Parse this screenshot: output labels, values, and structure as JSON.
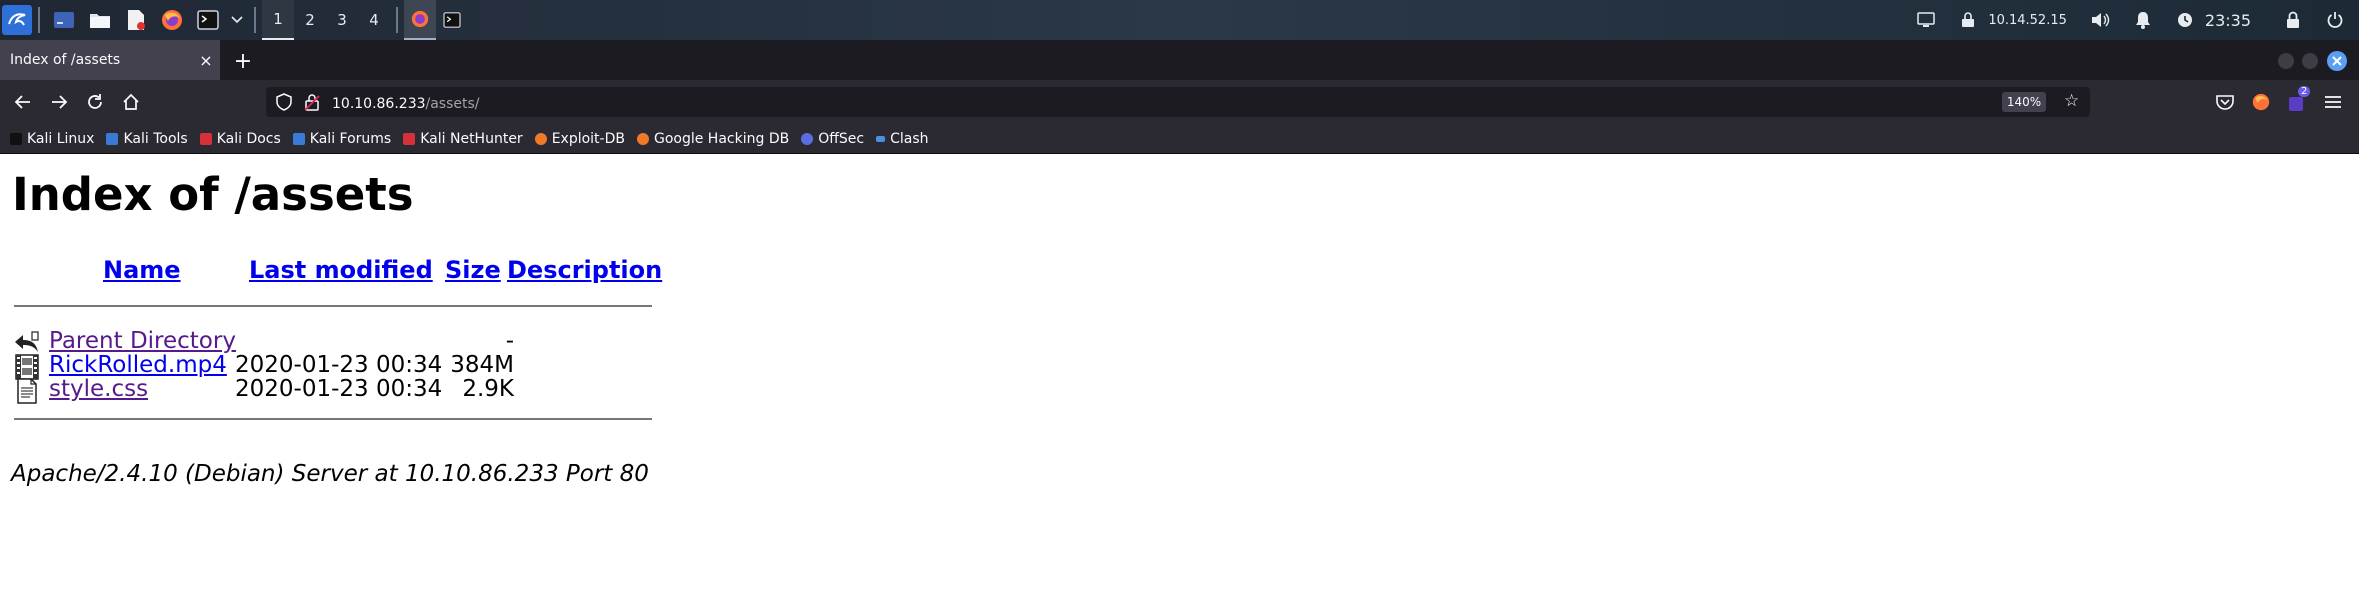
{
  "panel": {
    "workspaces": [
      "1",
      "2",
      "3",
      "4"
    ],
    "ip": "10.14.52.15",
    "clock": "23:35"
  },
  "browser": {
    "tab_title": "Index of /assets",
    "tab_close": "×",
    "new_tab": "+",
    "url_host": "10.10.86.233",
    "url_path": "/assets/",
    "zoom": "140%",
    "extension_badge": "2"
  },
  "bookmarks": [
    {
      "label": "Kali Linux",
      "icon": "kali-dragon-icon",
      "color": "#111111"
    },
    {
      "label": "Kali Tools",
      "icon": "kali-tools-icon",
      "color": "#3a7bd5"
    },
    {
      "label": "Kali Docs",
      "icon": "kali-docs-icon",
      "color": "#d6303a"
    },
    {
      "label": "Kali Forums",
      "icon": "kali-forums-icon",
      "color": "#3a7bd5"
    },
    {
      "label": "Kali NetHunter",
      "icon": "nethunter-icon",
      "color": "#d6303a"
    },
    {
      "label": "Exploit-DB",
      "icon": "exploit-db-icon",
      "color": "#f07a28"
    },
    {
      "label": "Google Hacking DB",
      "icon": "ghdb-icon",
      "color": "#f07a28"
    },
    {
      "label": "OffSec",
      "icon": "offsec-icon",
      "color": "#5b6ee1"
    },
    {
      "label": "Clash",
      "icon": "clash-icon",
      "color": "#4a90e2"
    }
  ],
  "page": {
    "title": "Index of /assets",
    "columns": {
      "name": "Name",
      "last_modified": "Last modified",
      "size": "Size",
      "description": "Description"
    },
    "rows": [
      {
        "name": "Parent Directory",
        "date": "",
        "size": "-",
        "icon": "back-arrow-icon",
        "visited": true
      },
      {
        "name": "RickRolled.mp4",
        "date": "2020-01-23 00:34",
        "size": "384M",
        "icon": "movie-file-icon",
        "visited": false
      },
      {
        "name": "style.css",
        "date": "2020-01-23 00:34",
        "size": "2.9K",
        "icon": "text-file-icon",
        "visited": true
      }
    ],
    "footer": "Apache/2.4.10 (Debian) Server at 10.10.86.233 Port 80"
  }
}
